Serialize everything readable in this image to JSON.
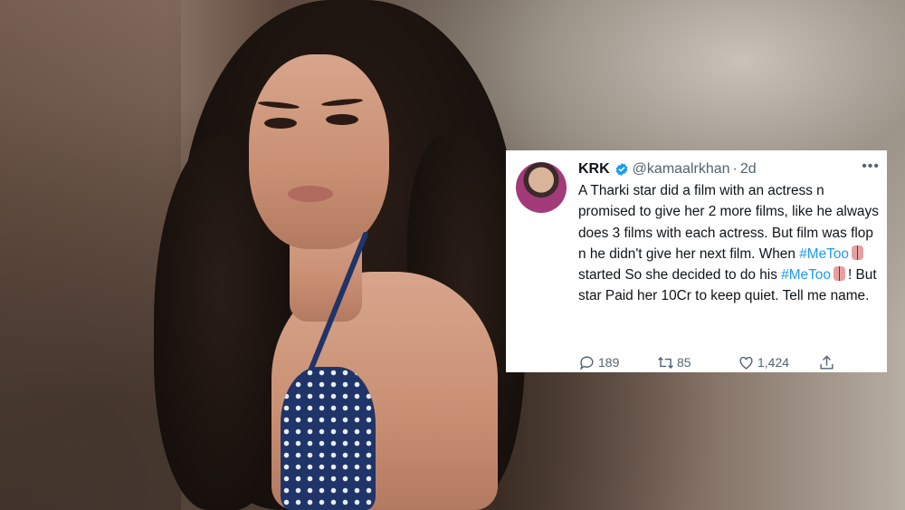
{
  "tweet": {
    "display_name": "KRK",
    "handle": "@kamaalrkhan",
    "separator": "·",
    "time": "2d",
    "more": "•••",
    "text_1": "A Tharki star did a film with an actress n promised to give her 2 more films, like he always does 3 films with each actress. But film was flop n he didn't give her next film. When ",
    "hashtag_1": "#MeToo",
    "text_2": " started So she decided to do his ",
    "hashtag_2": "#MeToo",
    "text_3": "! But star Paid her 10Cr to keep quiet. Tell me name.",
    "replies": "189",
    "retweets": "85",
    "likes": "1,424"
  },
  "colors": {
    "verified": "#1d9bf0",
    "hashtag": "#1d9bf0",
    "text": "#0f1419",
    "meta": "#536471"
  },
  "icons": [
    "verified-icon",
    "more-icon",
    "reply-icon",
    "retweet-icon",
    "like-icon",
    "share-icon",
    "emoji-icon"
  ]
}
